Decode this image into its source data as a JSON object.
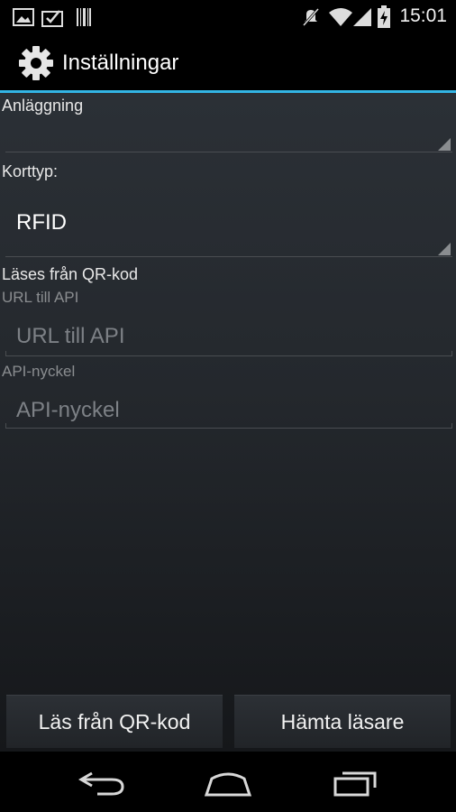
{
  "status_bar": {
    "time": "15:01",
    "icons": [
      "image-notification-icon",
      "inbox-notification-icon",
      "barcode-notification-icon",
      "mute-icon",
      "wifi-icon",
      "signal-icon",
      "battery-charging-icon"
    ]
  },
  "action_bar": {
    "title": "Inställningar",
    "icon": "gear-icon"
  },
  "form": {
    "facility_label": "Anläggning",
    "facility_value": "",
    "card_type_label": "Korttyp:",
    "card_type_value": "RFID",
    "qr_section_label": "Läses från QR-kod",
    "api_url_label": "URL till API",
    "api_url_placeholder": "URL till API",
    "api_key_label": "API-nyckel",
    "api_key_placeholder": "API-nyckel"
  },
  "buttons": {
    "read_qr": "Läs från QR-kod",
    "fetch_readers": "Hämta läsare"
  },
  "nav_bar": {
    "icons": [
      "back-icon",
      "home-icon",
      "recents-icon"
    ]
  },
  "colors": {
    "accent": "#33b5e5",
    "background": "#24282d"
  }
}
